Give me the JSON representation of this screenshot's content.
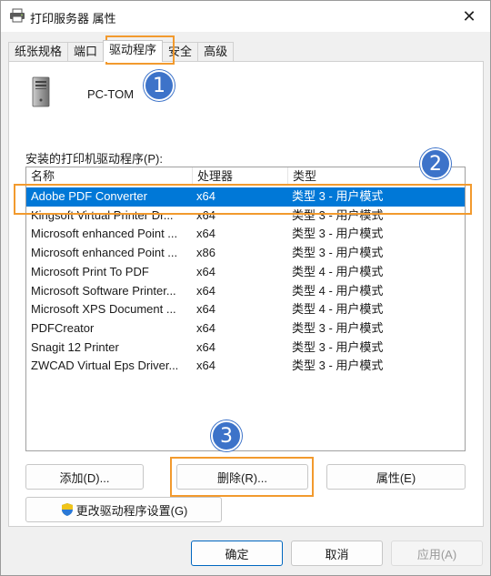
{
  "window": {
    "title": "打印服务器 属性",
    "close_label": "✕"
  },
  "tabs": [
    {
      "label": "纸张规格"
    },
    {
      "label": "端口"
    },
    {
      "label": "驱动程序"
    },
    {
      "label": "安全"
    },
    {
      "label": "高级"
    }
  ],
  "active_tab": "驱动程序",
  "server": {
    "name": "PC-TOM"
  },
  "driver_list": {
    "label": "安装的打印机驱动程序(P):",
    "columns": [
      "名称",
      "处理器",
      "类型"
    ],
    "rows": [
      {
        "name": "Adobe PDF Converter",
        "processor": "x64",
        "type": "类型 3 - 用户模式",
        "selected": true
      },
      {
        "name": "Kingsoft Virtual Printer Dr...",
        "processor": "x64",
        "type": "类型 3 - 用户模式"
      },
      {
        "name": "Microsoft enhanced Point ...",
        "processor": "x64",
        "type": "类型 3 - 用户模式"
      },
      {
        "name": "Microsoft enhanced Point ...",
        "processor": "x86",
        "type": "类型 3 - 用户模式"
      },
      {
        "name": "Microsoft Print To PDF",
        "processor": "x64",
        "type": "类型 4 - 用户模式"
      },
      {
        "name": "Microsoft Software Printer...",
        "processor": "x64",
        "type": "类型 4 - 用户模式"
      },
      {
        "name": "Microsoft XPS Document ...",
        "processor": "x64",
        "type": "类型 4 - 用户模式"
      },
      {
        "name": "PDFCreator",
        "processor": "x64",
        "type": "类型 3 - 用户模式"
      },
      {
        "name": "Snagit 12 Printer",
        "processor": "x64",
        "type": "类型 3 - 用户模式"
      },
      {
        "name": "ZWCAD Virtual Eps Driver...",
        "processor": "x64",
        "type": "类型 3 - 用户模式"
      }
    ]
  },
  "buttons": {
    "add": "添加(D)...",
    "remove": "删除(R)...",
    "properties": "属性(E)",
    "change_settings": "更改驱动程序设置(G)",
    "ok": "确定",
    "cancel": "取消",
    "apply": "应用(A)"
  },
  "annotations": [
    {
      "number": "1"
    },
    {
      "number": "2"
    },
    {
      "number": "3"
    }
  ],
  "colors": {
    "selection": "#0078d7",
    "highlight": "#f29a2e",
    "badge": "#3d73c9"
  },
  "icons": {
    "title": "printer-icon",
    "server": "computer-tower-icon",
    "shield": "uac-shield-icon",
    "close": "close-icon"
  }
}
